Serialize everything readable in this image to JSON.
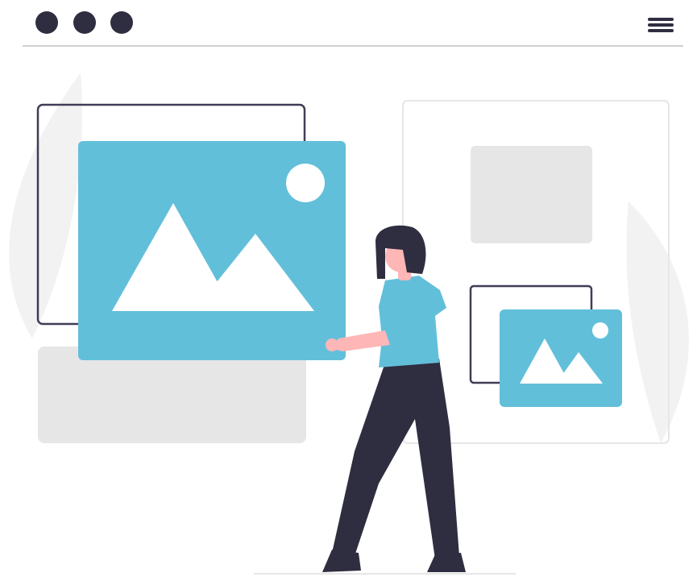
{
  "window": {
    "controls": [
      {
        "name": "window-dot-1"
      },
      {
        "name": "window-dot-2"
      },
      {
        "name": "window-dot-3"
      }
    ],
    "menu_icon": "hamburger-menu-icon"
  },
  "colors": {
    "dark": "#2f2e41",
    "accent": "#62bfda",
    "light_gray": "#e6e6e6",
    "faint_gray": "#f2f2f2",
    "frame_border": "#3f3d56",
    "skin": "#ffb6b6",
    "divider": "#d0d0d0",
    "white": "#ffffff"
  },
  "icons": [
    "image-placeholder-icon",
    "mountain-icon",
    "sun-icon"
  ]
}
